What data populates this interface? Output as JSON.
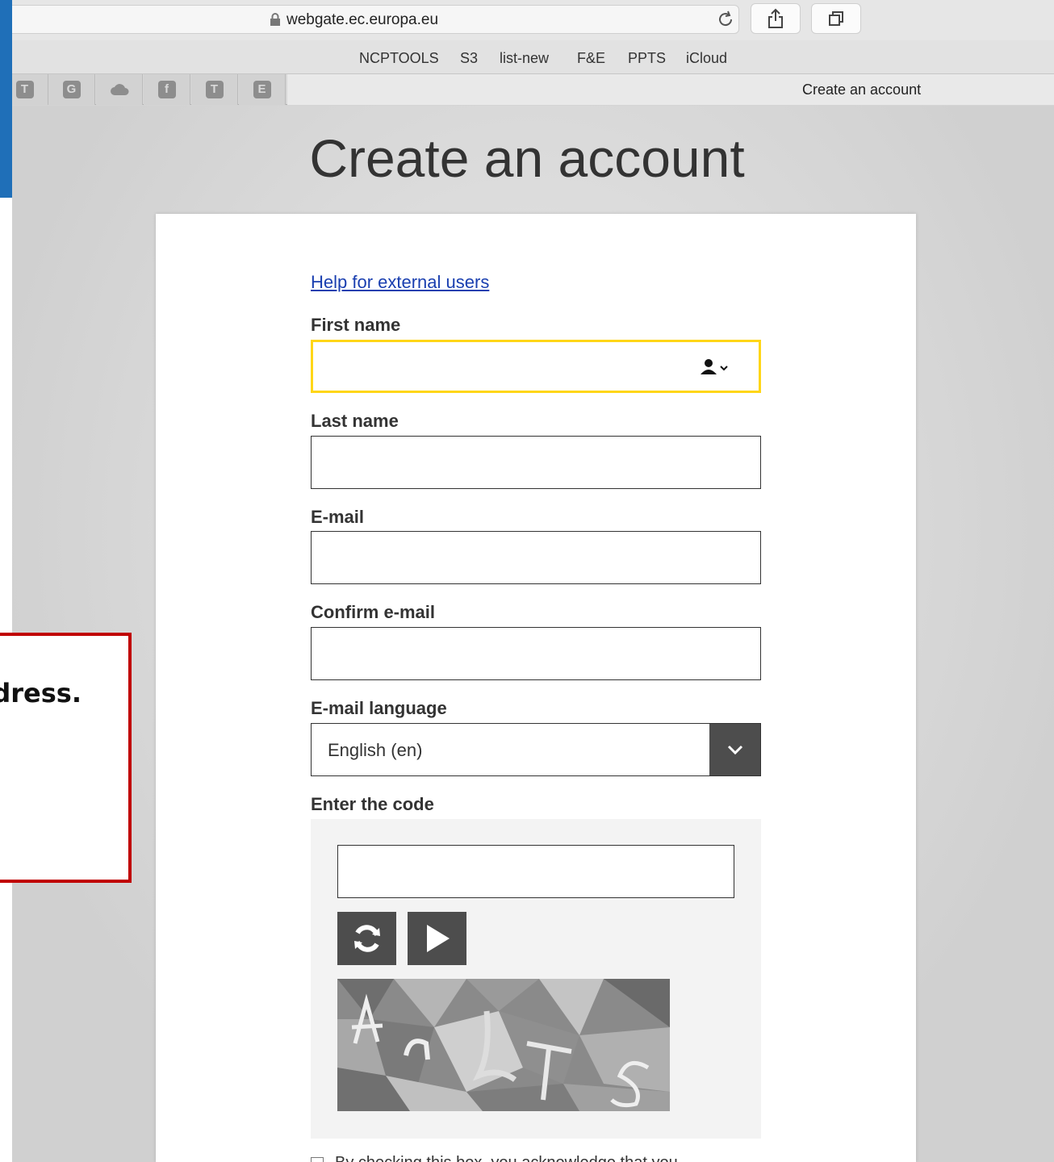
{
  "browser": {
    "url": "webgate.ec.europa.eu",
    "favorites": [
      "NCPTOOLS",
      "S3",
      "list-new",
      "F&E",
      "PPTS",
      "iCloud"
    ],
    "tab_title": "Create an account",
    "tab_icons": [
      {
        "icon": "t-letter-icon",
        "glyph": "T"
      },
      {
        "icon": "g-letter-icon",
        "glyph": "G"
      },
      {
        "icon": "cloud-icon",
        "glyph": ""
      },
      {
        "icon": "facebook-icon",
        "glyph": "f"
      },
      {
        "icon": "t-letter-icon",
        "glyph": "T"
      },
      {
        "icon": "e-letter-icon",
        "glyph": "E"
      }
    ]
  },
  "page": {
    "title": "Create an account",
    "help_link": "Help for external users",
    "fields": {
      "first_name": {
        "label": "First name",
        "value": ""
      },
      "last_name": {
        "label": "Last name",
        "value": ""
      },
      "email": {
        "label": "E-mail",
        "value": ""
      },
      "confirm_email": {
        "label": "Confirm e-mail",
        "value": ""
      },
      "email_language": {
        "label": "E-mail language",
        "value": "English (en)"
      },
      "code": {
        "label": "Enter the code",
        "value": ""
      }
    },
    "checkbox_text": "By checking this box, you acknowledge that you"
  },
  "callout": {
    "text": "dress."
  },
  "colors": {
    "focus": "#ffd617",
    "link": "#1a3fb0",
    "callout_border": "#c00000",
    "strip": "#1f6fb8"
  }
}
